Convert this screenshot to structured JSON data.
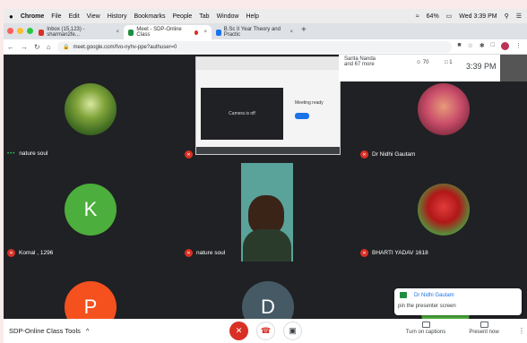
{
  "menubar": {
    "apple": "",
    "app": "Chrome",
    "items": [
      "File",
      "Edit",
      "View",
      "History",
      "Bookmarks",
      "People",
      "Tab",
      "Window",
      "Help"
    ],
    "battery": "64%",
    "datetime": "Wed 3:39 PM"
  },
  "tabs": [
    {
      "label": "Inbox (15,123) - sharman2fe...",
      "color": "#d93025"
    },
    {
      "label": "Meet - SDP-Online Class",
      "color": "#1e8e3e"
    },
    {
      "label": "B.Sc II Year Theory and Practic",
      "color": "#1a73e8"
    }
  ],
  "address": {
    "url": "meet.google.com/fvo-nyhv-ppe?authuser=0"
  },
  "topstrip": {
    "joined_line1": "Sarita Nanda",
    "joined_line2": "and 67 more",
    "participant_count": "70",
    "chat_count": "1",
    "time": "3:39 PM",
    "you_label": "You"
  },
  "presentation": {
    "camera_text": "Camera is off",
    "ready_text": "Meeting ready"
  },
  "participants": [
    {
      "name": "nature soul",
      "type": "image",
      "active": true
    },
    {
      "name": "Dr Nidhi Gautam",
      "type": "image"
    },
    {
      "name": "Komal , 1296",
      "letter": "K",
      "color": "#4cae3c"
    },
    {
      "name": "nature soul",
      "type": "video"
    },
    {
      "name": "BHARTI YADAV 1618",
      "type": "image"
    },
    {
      "letter": "P",
      "color": "#f4511e"
    },
    {
      "letter": "D",
      "color": "#455a64"
    }
  ],
  "toast": {
    "sender": "Dr Nidhi Gautam",
    "message": "pin the presenter screen"
  },
  "bottombar": {
    "meeting_title": "SDP-Online Class Tools",
    "chevron": "^",
    "captions_label": "Turn on captions",
    "present_label": "Present now",
    "more": "⋮"
  },
  "colors": {
    "end_call": "#d93025",
    "meet_bg": "#202124"
  }
}
